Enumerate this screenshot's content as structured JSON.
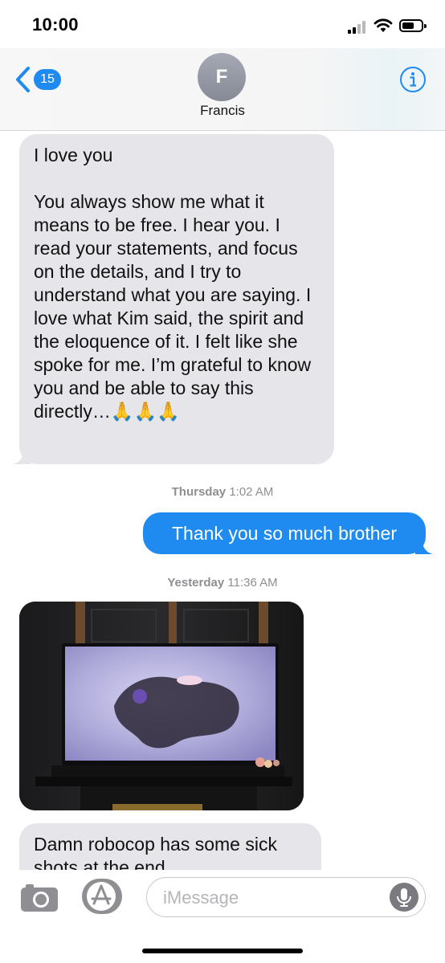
{
  "status_bar": {
    "time": "10:00",
    "icons": [
      "cellular-signal-icon",
      "wifi-icon",
      "battery-icon"
    ]
  },
  "header": {
    "back_badge": "15",
    "avatar_initial": "F",
    "contact_name": "Francis",
    "info_icon": "info-icon",
    "accent_color": "#1f8bf0"
  },
  "messages": [
    {
      "direction": "incoming",
      "text": "I love you\n\nYou always show me what it means to be free. I hear you. I read your statements, and focus on the details, and I try to understand what you are saying. I love what Kim said, the spirit and the eloquence of it. I felt like she spoke for me. I’m grateful to know you and be able to say this directly…🙏🙏🙏"
    },
    {
      "type": "timestamp",
      "day": "Thursday",
      "time": "1:02 AM"
    },
    {
      "direction": "outgoing",
      "text": "Thank you so much brother"
    },
    {
      "type": "timestamp",
      "day": "Yesterday",
      "time": "11:36 AM"
    },
    {
      "direction": "incoming",
      "type": "photo",
      "description_icon": "photo-attachment"
    },
    {
      "direction": "incoming",
      "text": "Damn robocop has some sick shots at the end"
    }
  ],
  "input_bar": {
    "placeholder": "iMessage",
    "icons": [
      "camera-icon",
      "app-store-icon",
      "microphone-icon"
    ]
  },
  "colors": {
    "incoming_bubble": "#e5e5ea",
    "outgoing_bubble": "#1f8bf0",
    "timestamp_text": "#8e8e93"
  }
}
